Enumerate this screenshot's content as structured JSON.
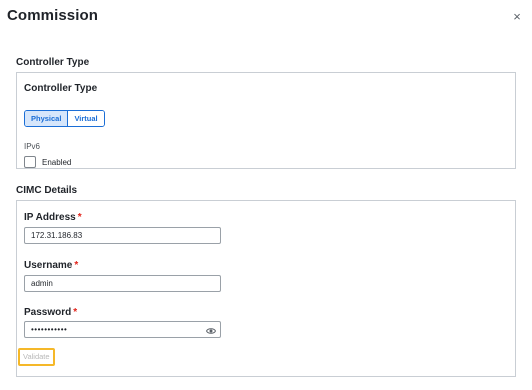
{
  "dialog": {
    "title": "Commission",
    "close_glyph": "×"
  },
  "controller_type_section": {
    "title": "Controller Type",
    "field_label": "Controller Type",
    "options": [
      "Physical",
      "Virtual"
    ],
    "selected": "Physical",
    "ipv6_label": "IPv6",
    "enabled_label": "Enabled",
    "enabled_checked": false
  },
  "cimc_section": {
    "title": "CIMC Details",
    "ip_label": "IP Address",
    "ip_value": "172.31.186.83",
    "username_label": "Username",
    "username_value": "admin",
    "password_label": "Password",
    "password_masked": "•••••••••••",
    "required_marker": "*",
    "validate_label": "Validate"
  },
  "colors": {
    "accent": "#1b6ed6",
    "required": "#e2231a",
    "focus_outline": "#f5b829"
  }
}
